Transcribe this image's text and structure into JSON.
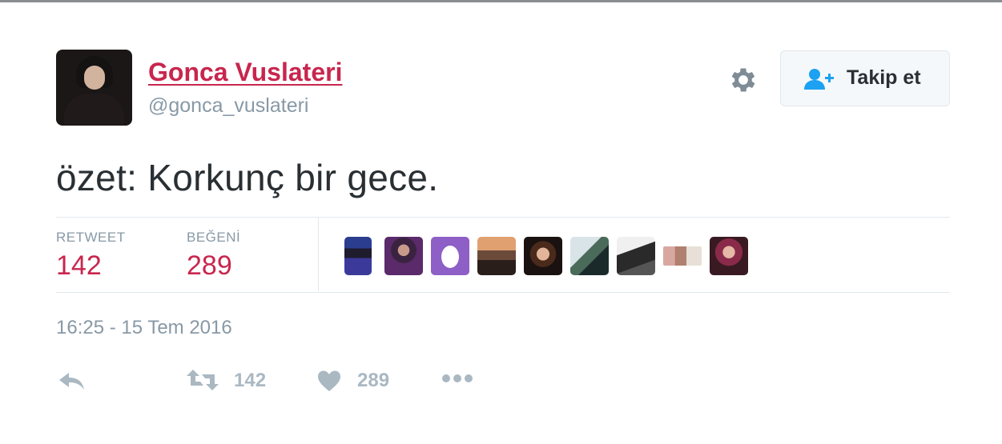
{
  "user": {
    "display_name": "Gonca Vuslateri",
    "handle": "@gonca_vuslateri",
    "avatar_icon": "profile-photo"
  },
  "follow_button": {
    "label": "Takip et",
    "icon": "add-user-icon"
  },
  "settings": {
    "icon": "gear-icon"
  },
  "tweet": {
    "text": "özet: Korkunç bir gece.",
    "timestamp": "16:25 - 15 Tem 2016"
  },
  "stats": {
    "retweet_label": "RETWEET",
    "retweet_count": "142",
    "like_label": "BEĞENİ",
    "like_count": "289"
  },
  "likers": [
    {
      "name": "liker-avatar-1"
    },
    {
      "name": "liker-avatar-2"
    },
    {
      "name": "liker-avatar-3"
    },
    {
      "name": "liker-avatar-4"
    },
    {
      "name": "liker-avatar-5"
    },
    {
      "name": "liker-avatar-6"
    },
    {
      "name": "liker-avatar-7"
    },
    {
      "name": "liker-avatar-8"
    },
    {
      "name": "liker-avatar-9"
    }
  ],
  "actions": {
    "retweet_count": "142",
    "like_count": "289"
  },
  "colors": {
    "accent": "#c8264e",
    "muted": "#8899a6",
    "icon": "#aab8c2",
    "follow_icon": "#1da1f2"
  }
}
